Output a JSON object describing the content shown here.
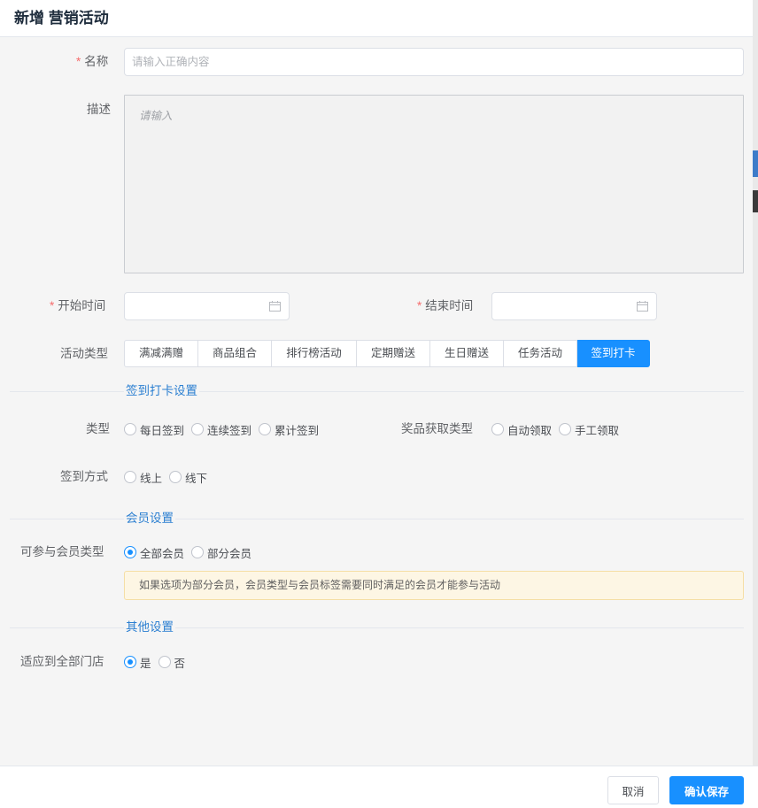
{
  "dialog": {
    "title": "新增 营销活动"
  },
  "form": {
    "name": {
      "label": "名称",
      "required": true,
      "placeholder": "请输入正确内容",
      "value": ""
    },
    "description": {
      "label": "描述",
      "placeholder": "请输入",
      "value": ""
    },
    "start_time": {
      "label": "开始时间",
      "required": true,
      "value": ""
    },
    "end_time": {
      "label": "结束时间",
      "required": true,
      "value": ""
    },
    "activity_type": {
      "label": "活动类型",
      "options": [
        "满减满赠",
        "商品组合",
        "排行榜活动",
        "定期赠送",
        "生日赠送",
        "任务活动",
        "签到打卡"
      ],
      "selected": "签到打卡"
    }
  },
  "checkin_section": {
    "title": "签到打卡设置",
    "type": {
      "label": "类型",
      "options": [
        "每日签到",
        "连续签到",
        "累计签到"
      ],
      "selected": null
    },
    "reward_type": {
      "label": "奖品获取类型",
      "options": [
        "自动领取",
        "手工领取"
      ],
      "selected": null
    },
    "method": {
      "label": "签到方式",
      "options": [
        "线上",
        "线下"
      ],
      "selected": null
    }
  },
  "member_section": {
    "title": "会员设置",
    "member_type": {
      "label": "可参与会员类型",
      "options": [
        "全部会员",
        "部分会员"
      ],
      "selected": "全部会员"
    },
    "notice": "如果选项为部分会员，会员类型与会员标签需要同时满足的会员才能参与活动"
  },
  "other_section": {
    "title": "其他设置",
    "all_stores": {
      "label": "适应到全部门店",
      "options": [
        "是",
        "否"
      ],
      "selected": "是"
    }
  },
  "footer": {
    "cancel_label": "取消",
    "save_label": "确认保存"
  },
  "colors": {
    "primary": "#1890ff",
    "required": "#f56c6c",
    "section_title": "#2b7fd1",
    "notice_bg": "#fdf6e4"
  },
  "icons": {
    "date_picker": "calendar-icon"
  }
}
